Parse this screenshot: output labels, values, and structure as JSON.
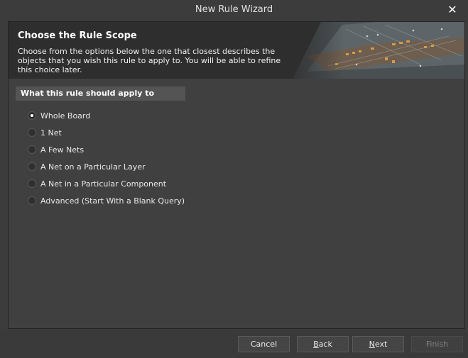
{
  "window": {
    "title": "New Rule Wizard",
    "close_glyph": "✕"
  },
  "banner": {
    "heading": "Choose the Rule Scope",
    "description": "Choose from the options below the one that closest describes the objects that you wish this rule to apply to. You will be able to refine this choice later."
  },
  "scope": {
    "section_title": "What this rule should apply to",
    "selected": "Whole Board",
    "options": [
      {
        "label": "Whole Board",
        "checked": true
      },
      {
        "label": "1 Net",
        "checked": false
      },
      {
        "label": "A Few Nets",
        "checked": false
      },
      {
        "label": "A Net on a Particular Layer",
        "checked": false
      },
      {
        "label": "A Net in a Particular Component",
        "checked": false
      },
      {
        "label": "Advanced (Start With a Blank Query)",
        "checked": false
      }
    ]
  },
  "buttons": {
    "cancel": {
      "label": "Cancel"
    },
    "back": {
      "mnemonic": "B",
      "rest": "ack"
    },
    "next": {
      "mnemonic": "N",
      "rest": "ext"
    },
    "finish": {
      "label": "Finish",
      "enabled": false
    }
  }
}
